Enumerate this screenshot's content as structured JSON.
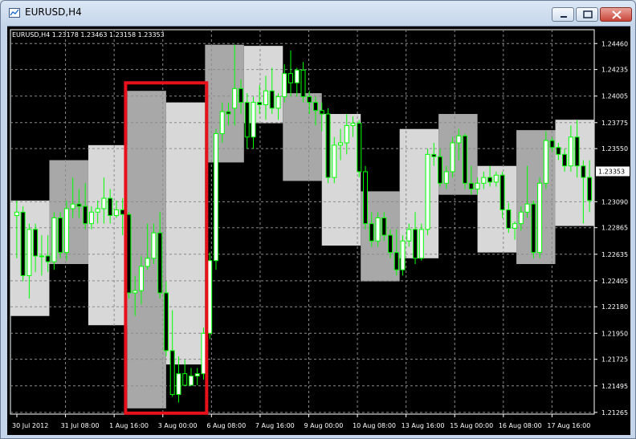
{
  "window": {
    "title": "EURUSD,H4"
  },
  "chart_data": {
    "type": "candlestick",
    "symbol_header": "EURUSD,H4  1.23178 1.23463 1.23158 1.23353",
    "current_price_label": "1.23353",
    "current_price": 1.23353,
    "ylim": [
      1.2125,
      1.2458
    ],
    "y_tick_labels": [
      "1.24460",
      "1.24235",
      "1.24005",
      "1.23775",
      "1.23550",
      "1.23090",
      "1.22865",
      "1.22635",
      "1.22405",
      "1.22180",
      "1.21950",
      "1.21725",
      "1.21495",
      "1.21265"
    ],
    "x_tick_labels": [
      "30 Jul 2012",
      "31 Jul 08:00",
      "1 Aug 16:00",
      "3 Aug 00:00",
      "6 Aug 08:00",
      "7 Aug 16:00",
      "9 Aug 00:00",
      "10 Aug 08:00",
      "13 Aug 16:00",
      "15 Aug 00:00",
      "16 Aug 08:00",
      "17 Aug 16:00"
    ],
    "grid": true,
    "colors": {
      "background": "#000000",
      "bull": "#00ff00",
      "bear_body": "#000000",
      "box_light": "#d8d8d8",
      "box_dark": "#a8a8a8",
      "highlight": "#e8101a"
    },
    "period_boxes": [
      {
        "high": 1.231,
        "low": 1.221,
        "shade": "light"
      },
      {
        "high": 1.2345,
        "low": 1.2255,
        "shade": "dark"
      },
      {
        "high": 1.2358,
        "low": 1.2202,
        "shade": "light"
      },
      {
        "high": 1.2405,
        "low": 1.213,
        "shade": "dark"
      },
      {
        "high": 1.2395,
        "low": 1.2168,
        "shade": "light"
      },
      {
        "high": 1.2445,
        "low": 1.2343,
        "shade": "dark"
      },
      {
        "high": 1.2444,
        "low": 1.2377,
        "shade": "light"
      },
      {
        "high": 1.2403,
        "low": 1.2327,
        "shade": "dark"
      },
      {
        "high": 1.2385,
        "low": 1.2271,
        "shade": "light"
      },
      {
        "high": 1.2318,
        "low": 1.224,
        "shade": "dark"
      },
      {
        "high": 1.2372,
        "low": 1.226,
        "shade": "light"
      },
      {
        "high": 1.2385,
        "low": 1.2315,
        "shade": "dark"
      },
      {
        "high": 1.234,
        "low": 1.2265,
        "shade": "light"
      },
      {
        "high": 1.2371,
        "low": 1.2255,
        "shade": "dark"
      },
      {
        "high": 1.238,
        "low": 1.2288,
        "shade": "light"
      }
    ],
    "candles": [
      {
        "o": 1.2297,
        "h": 1.231,
        "l": 1.226,
        "c": 1.23
      },
      {
        "o": 1.23,
        "h": 1.2305,
        "l": 1.224,
        "c": 1.2245
      },
      {
        "o": 1.2245,
        "h": 1.229,
        "l": 1.2225,
        "c": 1.2285
      },
      {
        "o": 1.2285,
        "h": 1.229,
        "l": 1.2248,
        "c": 1.2262
      },
      {
        "o": 1.2262,
        "h": 1.228,
        "l": 1.2245,
        "c": 1.2262
      },
      {
        "o": 1.2262,
        "h": 1.228,
        "l": 1.2248,
        "c": 1.2257
      },
      {
        "o": 1.2257,
        "h": 1.23,
        "l": 1.225,
        "c": 1.2295
      },
      {
        "o": 1.2295,
        "h": 1.23,
        "l": 1.226,
        "c": 1.2265
      },
      {
        "o": 1.2265,
        "h": 1.231,
        "l": 1.2258,
        "c": 1.2303
      },
      {
        "o": 1.2303,
        "h": 1.233,
        "l": 1.2295,
        "c": 1.2307
      },
      {
        "o": 1.2307,
        "h": 1.232,
        "l": 1.2295,
        "c": 1.2305
      },
      {
        "o": 1.2305,
        "h": 1.2325,
        "l": 1.2285,
        "c": 1.229
      },
      {
        "o": 1.229,
        "h": 1.2305,
        "l": 1.2285,
        "c": 1.23
      },
      {
        "o": 1.23,
        "h": 1.231,
        "l": 1.229,
        "c": 1.2303
      },
      {
        "o": 1.2303,
        "h": 1.233,
        "l": 1.229,
        "c": 1.2312
      },
      {
        "o": 1.2312,
        "h": 1.232,
        "l": 1.229,
        "c": 1.2297
      },
      {
        "o": 1.2297,
        "h": 1.231,
        "l": 1.2295,
        "c": 1.2302
      },
      {
        "o": 1.2302,
        "h": 1.2312,
        "l": 1.228,
        "c": 1.2298
      },
      {
        "o": 1.2298,
        "h": 1.23,
        "l": 1.2225,
        "c": 1.223
      },
      {
        "o": 1.223,
        "h": 1.2245,
        "l": 1.221,
        "c": 1.2232
      },
      {
        "o": 1.2232,
        "h": 1.2262,
        "l": 1.222,
        "c": 1.2253
      },
      {
        "o": 1.2253,
        "h": 1.229,
        "l": 1.225,
        "c": 1.226
      },
      {
        "o": 1.226,
        "h": 1.229,
        "l": 1.2255,
        "c": 1.2282
      },
      {
        "o": 1.2282,
        "h": 1.23,
        "l": 1.2225,
        "c": 1.223
      },
      {
        "o": 1.223,
        "h": 1.224,
        "l": 1.2175,
        "c": 1.218
      },
      {
        "o": 1.218,
        "h": 1.2215,
        "l": 1.214,
        "c": 1.2142
      },
      {
        "o": 1.2142,
        "h": 1.2175,
        "l": 1.2135,
        "c": 1.216
      },
      {
        "o": 1.216,
        "h": 1.2172,
        "l": 1.215,
        "c": 1.215
      },
      {
        "o": 1.215,
        "h": 1.2165,
        "l": 1.215,
        "c": 1.2158
      },
      {
        "o": 1.2158,
        "h": 1.2165,
        "l": 1.215,
        "c": 1.216
      },
      {
        "o": 1.216,
        "h": 1.22,
        "l": 1.2155,
        "c": 1.2195
      },
      {
        "o": 1.2195,
        "h": 1.2265,
        "l": 1.219,
        "c": 1.2258
      },
      {
        "o": 1.2258,
        "h": 1.2372,
        "l": 1.225,
        "c": 1.2368
      },
      {
        "o": 1.2368,
        "h": 1.2395,
        "l": 1.236,
        "c": 1.2387
      },
      {
        "o": 1.2387,
        "h": 1.2395,
        "l": 1.2375,
        "c": 1.2385
      },
      {
        "o": 1.239,
        "h": 1.2445,
        "l": 1.2375,
        "c": 1.2407
      },
      {
        "o": 1.2407,
        "h": 1.2415,
        "l": 1.2385,
        "c": 1.2395
      },
      {
        "o": 1.2395,
        "h": 1.2403,
        "l": 1.2355,
        "c": 1.2365
      },
      {
        "o": 1.2365,
        "h": 1.24,
        "l": 1.2355,
        "c": 1.2395
      },
      {
        "o": 1.2395,
        "h": 1.241,
        "l": 1.2385,
        "c": 1.2393
      },
      {
        "o": 1.2393,
        "h": 1.2418,
        "l": 1.238,
        "c": 1.2405
      },
      {
        "o": 1.2405,
        "h": 1.2425,
        "l": 1.2385,
        "c": 1.239
      },
      {
        "o": 1.239,
        "h": 1.2403,
        "l": 1.238,
        "c": 1.24
      },
      {
        "o": 1.24,
        "h": 1.2428,
        "l": 1.2395,
        "c": 1.242
      },
      {
        "o": 1.242,
        "h": 1.244,
        "l": 1.24,
        "c": 1.2412
      },
      {
        "o": 1.2412,
        "h": 1.2425,
        "l": 1.24,
        "c": 1.2423
      },
      {
        "o": 1.2423,
        "h": 1.243,
        "l": 1.2395,
        "c": 1.24
      },
      {
        "o": 1.24,
        "h": 1.2405,
        "l": 1.2385,
        "c": 1.2395
      },
      {
        "o": 1.2395,
        "h": 1.24,
        "l": 1.2375,
        "c": 1.2388
      },
      {
        "o": 1.2388,
        "h": 1.2395,
        "l": 1.237,
        "c": 1.2385
      },
      {
        "o": 1.2385,
        "h": 1.239,
        "l": 1.2325,
        "c": 1.233
      },
      {
        "o": 1.233,
        "h": 1.2365,
        "l": 1.2325,
        "c": 1.2358
      },
      {
        "o": 1.2358,
        "h": 1.2372,
        "l": 1.2345,
        "c": 1.236
      },
      {
        "o": 1.236,
        "h": 1.2385,
        "l": 1.235,
        "c": 1.2375
      },
      {
        "o": 1.2375,
        "h": 1.2383,
        "l": 1.2365,
        "c": 1.2377
      },
      {
        "o": 1.2377,
        "h": 1.238,
        "l": 1.233,
        "c": 1.2335
      },
      {
        "o": 1.2335,
        "h": 1.234,
        "l": 1.2285,
        "c": 1.229
      },
      {
        "o": 1.229,
        "h": 1.23,
        "l": 1.227,
        "c": 1.2275
      },
      {
        "o": 1.2275,
        "h": 1.23,
        "l": 1.227,
        "c": 1.2295
      },
      {
        "o": 1.2295,
        "h": 1.23,
        "l": 1.2275,
        "c": 1.228
      },
      {
        "o": 1.228,
        "h": 1.2285,
        "l": 1.226,
        "c": 1.2265
      },
      {
        "o": 1.2265,
        "h": 1.2285,
        "l": 1.2245,
        "c": 1.225
      },
      {
        "o": 1.225,
        "h": 1.228,
        "l": 1.2245,
        "c": 1.2275
      },
      {
        "o": 1.2275,
        "h": 1.229,
        "l": 1.227,
        "c": 1.2285
      },
      {
        "o": 1.2285,
        "h": 1.23,
        "l": 1.2255,
        "c": 1.226
      },
      {
        "o": 1.226,
        "h": 1.229,
        "l": 1.2258,
        "c": 1.2285
      },
      {
        "o": 1.2285,
        "h": 1.2355,
        "l": 1.228,
        "c": 1.235
      },
      {
        "o": 1.235,
        "h": 1.236,
        "l": 1.234,
        "c": 1.2348
      },
      {
        "o": 1.2348,
        "h": 1.2355,
        "l": 1.2322,
        "c": 1.2325
      },
      {
        "o": 1.2325,
        "h": 1.234,
        "l": 1.232,
        "c": 1.2335
      },
      {
        "o": 1.2335,
        "h": 1.2365,
        "l": 1.233,
        "c": 1.236
      },
      {
        "o": 1.236,
        "h": 1.2372,
        "l": 1.2345,
        "c": 1.2366
      },
      {
        "o": 1.2366,
        "h": 1.2368,
        "l": 1.232,
        "c": 1.2325
      },
      {
        "o": 1.2325,
        "h": 1.234,
        "l": 1.2315,
        "c": 1.232
      },
      {
        "o": 1.232,
        "h": 1.233,
        "l": 1.2315,
        "c": 1.2325
      },
      {
        "o": 1.2325,
        "h": 1.2335,
        "l": 1.232,
        "c": 1.233
      },
      {
        "o": 1.233,
        "h": 1.234,
        "l": 1.2322,
        "c": 1.2326
      },
      {
        "o": 1.2326,
        "h": 1.2335,
        "l": 1.2322,
        "c": 1.2332
      },
      {
        "o": 1.2332,
        "h": 1.2335,
        "l": 1.2295,
        "c": 1.2302
      },
      {
        "o": 1.2302,
        "h": 1.2308,
        "l": 1.2282,
        "c": 1.2286
      },
      {
        "o": 1.2286,
        "h": 1.2292,
        "l": 1.2276,
        "c": 1.229
      },
      {
        "o": 1.229,
        "h": 1.2305,
        "l": 1.2284,
        "c": 1.23
      },
      {
        "o": 1.23,
        "h": 1.234,
        "l": 1.2295,
        "c": 1.2307
      },
      {
        "o": 1.2307,
        "h": 1.231,
        "l": 1.226,
        "c": 1.2265
      },
      {
        "o": 1.2265,
        "h": 1.233,
        "l": 1.226,
        "c": 1.2325
      },
      {
        "o": 1.2325,
        "h": 1.237,
        "l": 1.232,
        "c": 1.2362
      },
      {
        "o": 1.2362,
        "h": 1.2365,
        "l": 1.2352,
        "c": 1.2356
      },
      {
        "o": 1.2356,
        "h": 1.236,
        "l": 1.2345,
        "c": 1.235
      },
      {
        "o": 1.235,
        "h": 1.2355,
        "l": 1.2335,
        "c": 1.234
      },
      {
        "o": 1.234,
        "h": 1.2375,
        "l": 1.2335,
        "c": 1.2365
      },
      {
        "o": 1.2365,
        "h": 1.238,
        "l": 1.233,
        "c": 1.234
      },
      {
        "o": 1.234,
        "h": 1.2345,
        "l": 1.229,
        "c": 1.233
      },
      {
        "o": 1.233,
        "h": 1.2345,
        "l": 1.23,
        "c": 1.231
      }
    ],
    "highlight_rect": {
      "from_box": 3,
      "to_box": 4
    }
  }
}
